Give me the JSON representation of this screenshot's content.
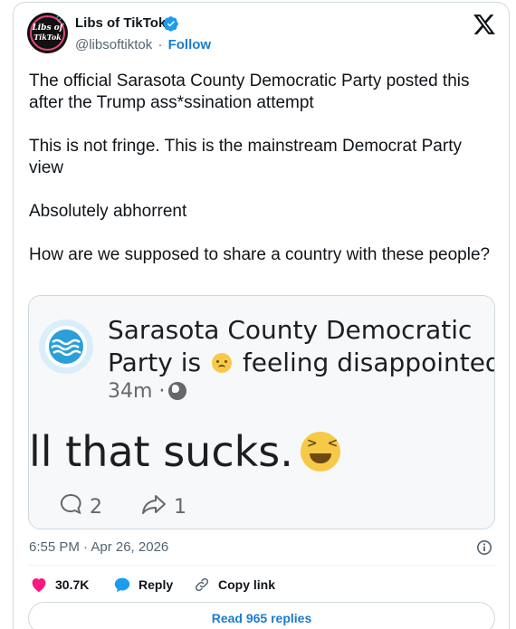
{
  "author": {
    "name": "Libs of TikTok",
    "handle": "@libsoftiktok",
    "separator": "·",
    "follow_label": "Follow",
    "avatar_text_line1": "Libs of",
    "avatar_text_line2": "TikTok"
  },
  "tweet": {
    "paragraphs": [
      "The official Sarasota County Democratic Party posted this after the Trump ass*ssination attempt",
      "This is not fringe. This is the mainstream Democrat Party view",
      "Absolutely abhorrent",
      "How are we supposed to share a country with these people?"
    ]
  },
  "media": {
    "page_name_line1": "Sarasota County Democratic",
    "page_name_line2_a": "Party is",
    "page_name_line2_b": "feeling disappointed.",
    "post_age": "34m ·",
    "post_text": "ll that sucks.",
    "comment_count": "2",
    "share_count": "1"
  },
  "meta": {
    "timestamp": "6:55 PM · Apr 26, 2026"
  },
  "actions": {
    "like_count": "30.7K",
    "reply_label": "Reply",
    "copy_link_label": "Copy link",
    "read_replies_label": "Read 965 replies"
  },
  "colors": {
    "accent": "#1d7bd0",
    "like": "#f91880",
    "text": "#0f1419",
    "muted": "#536471",
    "border": "#cfd9de"
  },
  "icons": [
    "verified-badge-icon",
    "x-logo-icon",
    "globe-icon",
    "comment-icon",
    "share-icon",
    "info-icon",
    "heart-icon",
    "reply-bubble-icon",
    "link-icon"
  ]
}
